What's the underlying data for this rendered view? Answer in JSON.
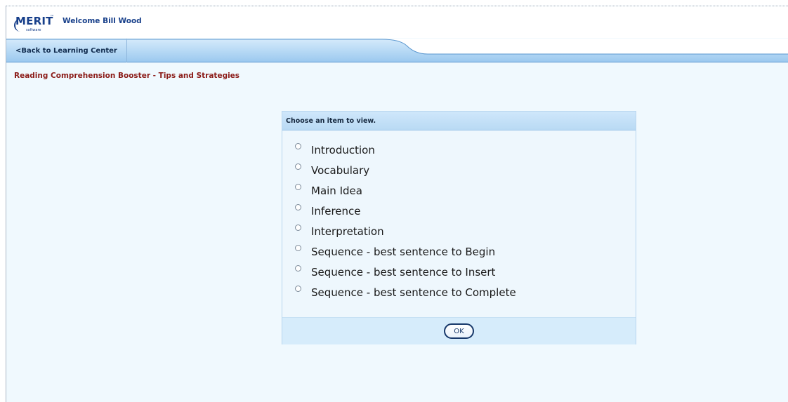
{
  "header": {
    "logo_text": "MERIT",
    "logo_trademark": "™",
    "logo_subtext": "software",
    "welcome": "Welcome Bill Wood"
  },
  "nav": {
    "back_label": "<Back to Learning Center"
  },
  "page": {
    "title": "Reading Comprehension Booster - Tips and Strategies"
  },
  "dialog": {
    "header": "Choose an item to view.",
    "options": [
      "Introduction",
      "Vocabulary",
      "Main Idea",
      "Inference",
      "Interpretation",
      "Sequence - best sentence to Begin",
      "Sequence - best sentence to Insert",
      "Sequence - best sentence to Complete"
    ],
    "ok_label": "OK"
  },
  "colors": {
    "brand_blue": "#173f8a",
    "title_red": "#8b1c19",
    "nav_blue": "#a9d0f1",
    "background": "#f0f9fe"
  }
}
